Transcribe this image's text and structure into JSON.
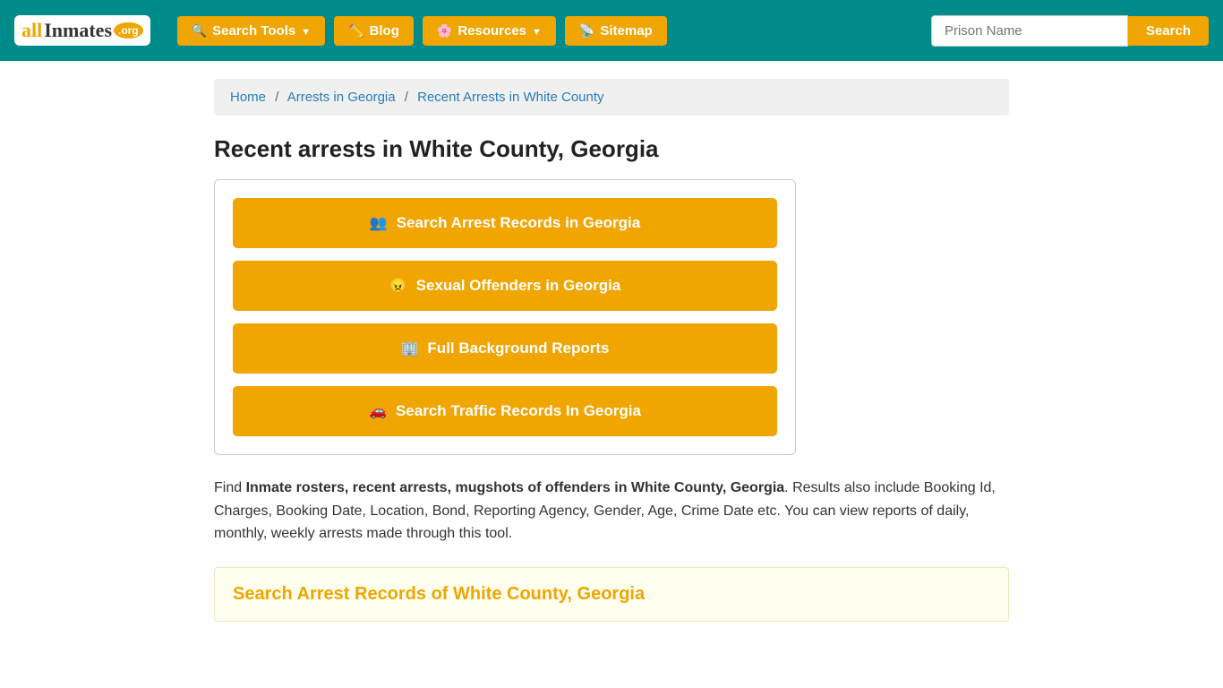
{
  "navbar": {
    "logo": {
      "all": "all",
      "inmates": "Inmates",
      "org": ".org"
    },
    "nav_items": [
      {
        "id": "search-tools",
        "label": "Search Tools",
        "icon": "search-icon",
        "dropdown": true
      },
      {
        "id": "blog",
        "label": "Blog",
        "icon": "blog-icon",
        "dropdown": false
      },
      {
        "id": "resources",
        "label": "Resources",
        "icon": "resources-icon",
        "dropdown": true
      },
      {
        "id": "sitemap",
        "label": "Sitemap",
        "icon": "sitemap-icon",
        "dropdown": false
      }
    ],
    "search_placeholder": "Prison Name",
    "search_button_label": "Search"
  },
  "breadcrumb": {
    "home": "Home",
    "arrests": "Arrests in Georgia",
    "current": "Recent Arrests in White County"
  },
  "main": {
    "page_title": "Recent arrests in White County, Georgia",
    "buttons": [
      {
        "id": "search-arrest",
        "label": "Search Arrest Records in Georgia",
        "icon": "people-icon"
      },
      {
        "id": "sexual-offenders",
        "label": "Sexual Offenders in Georgia",
        "icon": "offender-icon"
      },
      {
        "id": "background-reports",
        "label": "Full Background Reports",
        "icon": "building-icon"
      },
      {
        "id": "traffic-records",
        "label": "Search Traffic Records In Georgia",
        "icon": "car-icon"
      }
    ],
    "description_prefix": "Find ",
    "description_bold": "Inmate rosters, recent arrests, mugshots of offenders in White County, Georgia",
    "description_suffix": ". Results also include Booking Id, Charges, Booking Date, Location, Bond, Reporting Agency, Gender, Age, Crime Date etc. You can view reports of daily, monthly, weekly arrests made through this tool.",
    "search_section_title": "Search Arrest Records of White County, Georgia"
  }
}
